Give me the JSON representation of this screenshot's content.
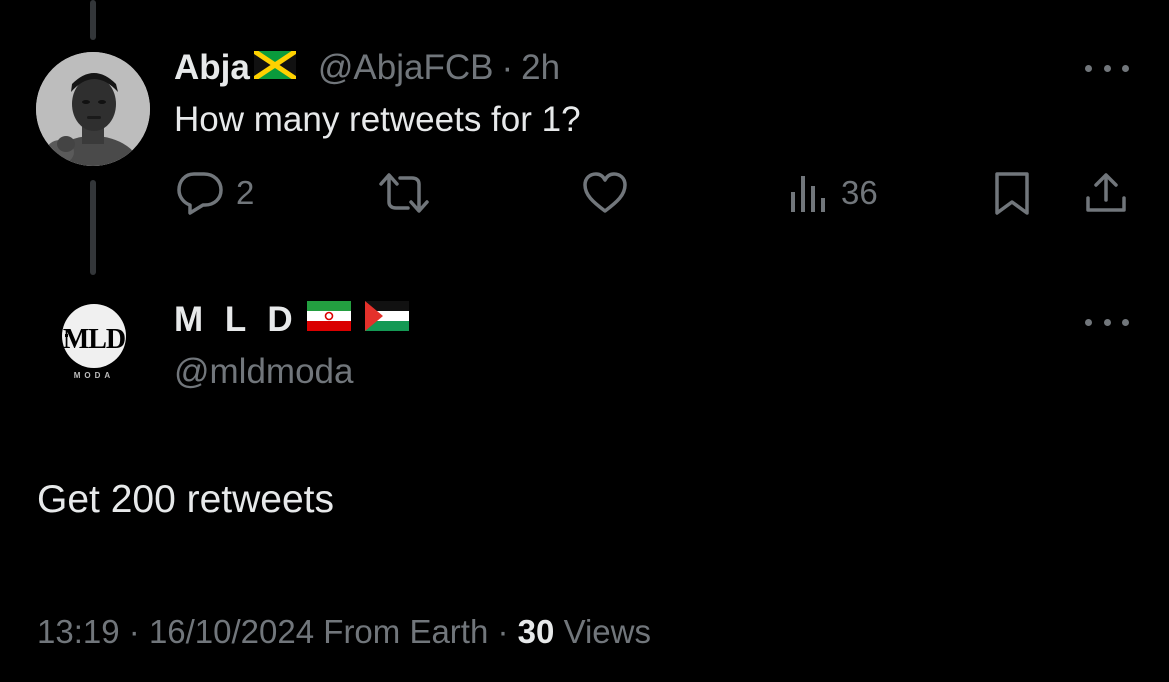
{
  "parent_tweet": {
    "display_name": "Abja",
    "flag_icon": "jamaica-flag-icon",
    "handle": "@AbjaFCB",
    "separator": "·",
    "time": "2h",
    "text": "How many retweets for 1?",
    "actions": {
      "reply_count": "2",
      "views_count": "36"
    }
  },
  "reply_tweet": {
    "display_name": "M L D",
    "flag_icons": [
      "iran-flag-icon",
      "palestine-flag-icon"
    ],
    "handle": "@mldmoda",
    "avatar_logo_text": "MLD",
    "avatar_logo_subtext": "MODA",
    "text": "Get 200 retweets",
    "meta": {
      "time": "13:19",
      "sep1": "·",
      "date": "16/10/2024",
      "source": "From Earth",
      "sep2": "·",
      "views_count": "30",
      "views_label": "Views"
    }
  },
  "colors": {
    "background": "#000000",
    "text_primary": "#e7e9ea",
    "text_muted": "#71767b",
    "thread_line": "#333639"
  }
}
